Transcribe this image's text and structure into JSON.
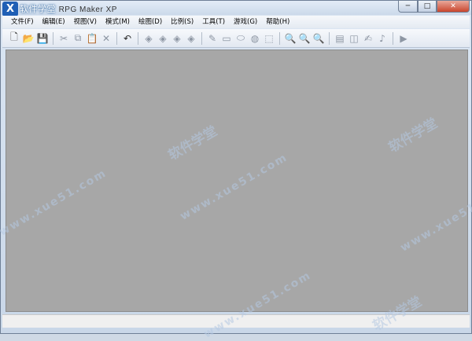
{
  "window": {
    "title": "RPG Maker XP",
    "logo_text": "软件学堂",
    "controls": {
      "minimize": "─",
      "maximize": "□",
      "close": "✕"
    }
  },
  "menu": [
    "文件(F)",
    "编辑(E)",
    "视图(V)",
    "模式(M)",
    "绘图(D)",
    "比例(S)",
    "工具(T)",
    "游戏(G)",
    "帮助(H)"
  ],
  "toolbar": [
    {
      "name": "new-icon",
      "glyph": "🗋",
      "active": true
    },
    {
      "name": "open-icon",
      "glyph": "📂",
      "active": true
    },
    {
      "name": "save-icon",
      "glyph": "💾",
      "active": false
    },
    {
      "sep": true
    },
    {
      "name": "cut-icon",
      "glyph": "✂",
      "active": false
    },
    {
      "name": "copy-icon",
      "glyph": "⧉",
      "active": false
    },
    {
      "name": "paste-icon",
      "glyph": "📋",
      "active": false
    },
    {
      "name": "delete-icon",
      "glyph": "✕",
      "active": false
    },
    {
      "sep": true
    },
    {
      "name": "undo-icon",
      "glyph": "↶",
      "active": true
    },
    {
      "sep": true
    },
    {
      "name": "layer1-icon",
      "glyph": "◈",
      "active": false
    },
    {
      "name": "layer2-icon",
      "glyph": "◈",
      "active": false
    },
    {
      "name": "layer3-icon",
      "glyph": "◈",
      "active": false
    },
    {
      "name": "event-layer-icon",
      "glyph": "◈",
      "active": false
    },
    {
      "sep": true
    },
    {
      "name": "pencil-icon",
      "glyph": "✎",
      "active": false
    },
    {
      "name": "rectangle-icon",
      "glyph": "▭",
      "active": false
    },
    {
      "name": "ellipse-icon",
      "glyph": "⬭",
      "active": false
    },
    {
      "name": "fill-icon",
      "glyph": "◍",
      "active": false
    },
    {
      "name": "select-icon",
      "glyph": "⬚",
      "active": false
    },
    {
      "sep": true
    },
    {
      "name": "zoom-1-icon",
      "glyph": "🔍",
      "active": false
    },
    {
      "name": "zoom-2-icon",
      "glyph": "🔍",
      "active": false
    },
    {
      "name": "zoom-4-icon",
      "glyph": "🔍",
      "active": false
    },
    {
      "sep": true
    },
    {
      "name": "database-icon",
      "glyph": "▤",
      "active": false
    },
    {
      "name": "materials-icon",
      "glyph": "◫",
      "active": false
    },
    {
      "name": "script-editor-icon",
      "glyph": "✍",
      "active": false
    },
    {
      "name": "sound-test-icon",
      "glyph": "♪",
      "active": false
    },
    {
      "sep": true
    },
    {
      "name": "playtest-icon",
      "glyph": "▶",
      "active": false
    }
  ],
  "watermarks": {
    "site": "www.xue51.com",
    "brand": "软件学堂"
  },
  "status": {
    "left": "",
    "right": ""
  }
}
